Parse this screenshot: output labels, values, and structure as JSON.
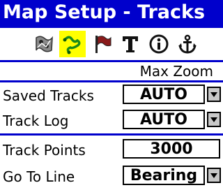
{
  "window": {
    "title": "Map Setup - Tracks"
  },
  "tabs": [
    {
      "name": "map-detail-icon",
      "selected": false
    },
    {
      "name": "tracks-icon",
      "selected": true
    },
    {
      "name": "waypoints-flag-icon",
      "selected": false
    },
    {
      "name": "text-icon",
      "selected": false
    },
    {
      "name": "info-icon",
      "selected": false
    },
    {
      "name": "marine-anchor-icon",
      "selected": false
    }
  ],
  "header": {
    "column_label": "Max Zoom"
  },
  "rows": {
    "saved_tracks": {
      "label": "Saved Tracks",
      "value": "AUTO"
    },
    "track_log": {
      "label": "Track Log",
      "value": "AUTO"
    },
    "track_points": {
      "label": "Track Points",
      "value": "3000"
    },
    "go_to_line": {
      "label": "Go To Line",
      "value": "Bearing"
    }
  },
  "colors": {
    "accent": "#0000cc",
    "highlight": "#ffff00",
    "background": "#ffffff"
  }
}
